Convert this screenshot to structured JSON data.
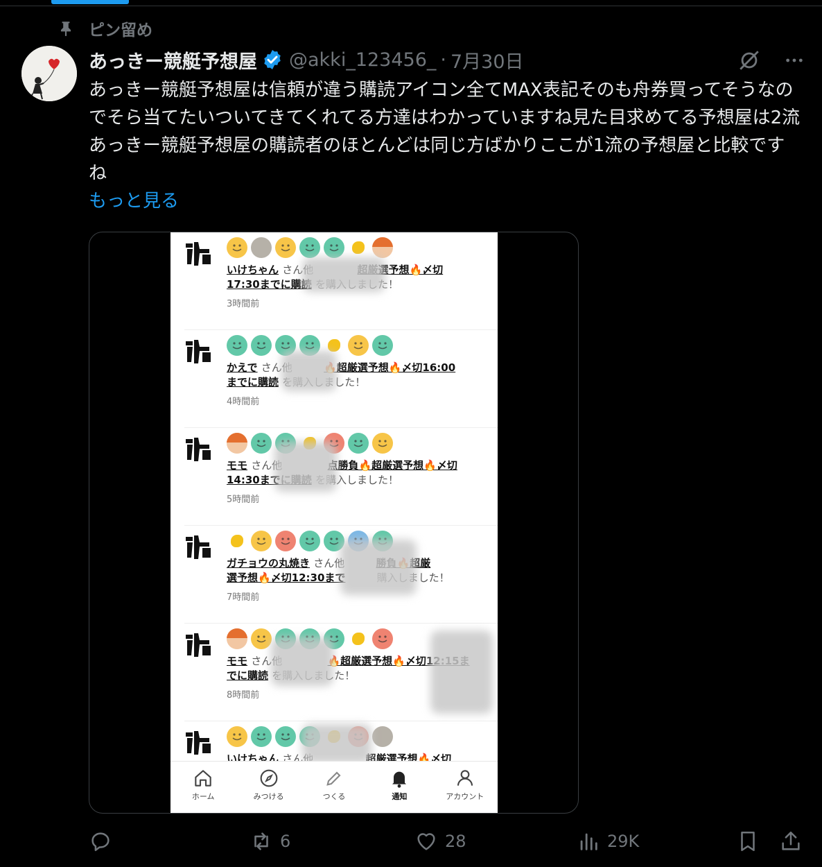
{
  "pin": {
    "label": "ピン留め"
  },
  "tweet": {
    "name": "あっきー競艇予想屋",
    "handle": "@akki_123456_",
    "dot": "·",
    "date": "7月30日",
    "text": "あっきー競艇予想屋は信頼が違う購読アイコン全てMAX表記そのも舟券買ってそうなのでそら当てたいついてきてくれてる方達はわかっていますね見た目求めてる予想屋は2流あっきー競艇予想屋の購読者のほとんどは同じ方ばかりここが1流の予想屋と比較ですね",
    "show_more": "もっと見る"
  },
  "embedded": {
    "rows": [
      {
        "avatars": [
          "yellow",
          "photo",
          "yellow",
          "teal",
          "teal",
          "bird",
          "anime"
        ],
        "user": "いけちゃん",
        "suffix": "さん他",
        "title": "超厳選予想🔥〆切",
        "line2_link": "17:30までに購読",
        "line2_rest": "を購入しました！",
        "time": "3時間前"
      },
      {
        "avatars": [
          "teal",
          "teal",
          "teal",
          "teal",
          "bird",
          "yellow",
          "teal"
        ],
        "user": "かえで",
        "suffix": "さん他",
        "title": "🔥超厳選予想🔥〆切16:00",
        "line2_link": "までに購読",
        "line2_rest": "を購入しました！",
        "time": "4時間前"
      },
      {
        "avatars": [
          "anime",
          "teal",
          "teal",
          "bird",
          "red",
          "teal",
          "yellow"
        ],
        "user": "モモ",
        "suffix": "さん他",
        "title": "点勝負🔥超厳選予想🔥〆切",
        "line2_link": "14:30までに購読",
        "line2_rest": "を購入しました！",
        "time": "5時間前"
      },
      {
        "avatars": [
          "bird",
          "yellow",
          "red",
          "teal",
          "teal",
          "blue",
          "teal"
        ],
        "user": "ガチョウの丸焼き",
        "suffix": "さん他",
        "title": "勝負🔥超厳",
        "line2_link": "選予想🔥〆切12:30まで",
        "line2_rest": "購入しました！",
        "time": "7時間前"
      },
      {
        "avatars": [
          "anime",
          "yellow",
          "teal",
          "teal",
          "teal",
          "bird",
          "red"
        ],
        "user": "モモ",
        "suffix": "さん他",
        "title": "🔥超厳選予想🔥〆切12:15ま",
        "line2_link": "でに購読",
        "line2_rest": "を購入しました！",
        "time": "8時間前"
      },
      {
        "avatars": [
          "yellow",
          "teal",
          "teal",
          "teal",
          "bird",
          "red",
          "photo"
        ],
        "user": "いけちゃん",
        "suffix": "さん他",
        "title": "超厳選予想🔥〆切",
        "line2_link": "",
        "line2_rest": "",
        "time": ""
      }
    ],
    "tabs": [
      {
        "label": "ホーム",
        "icon": "home-icon"
      },
      {
        "label": "みつける",
        "icon": "compass-icon"
      },
      {
        "label": "つくる",
        "icon": "pencil-icon"
      },
      {
        "label": "通知",
        "icon": "bell-icon"
      },
      {
        "label": "アカウント",
        "icon": "person-icon"
      }
    ]
  },
  "actions": {
    "reply": "",
    "retweet": "6",
    "like": "28",
    "views": "29K"
  },
  "colors": {
    "background": "#000000",
    "text": "#e7e9ea",
    "muted": "#71767b",
    "accent": "#1d9bf0"
  }
}
